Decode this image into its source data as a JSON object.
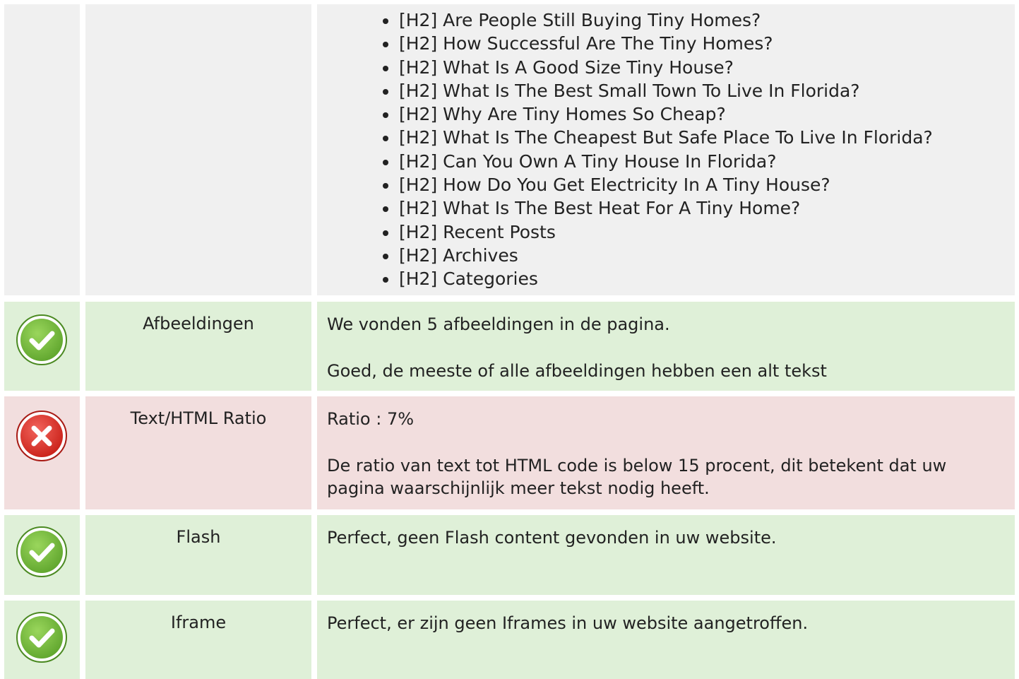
{
  "headings": {
    "items": [
      "[H2] Are People Still Buying Tiny Homes?",
      "[H2] How Successful Are The Tiny Homes?",
      "[H2] What Is A Good Size Tiny House?",
      "[H2] What Is The Best Small Town To Live In Florida?",
      "[H2] Why Are Tiny Homes So Cheap?",
      "[H2] What Is The Cheapest But Safe Place To Live In Florida?",
      "[H2] Can You Own A Tiny House In Florida?",
      "[H2] How Do You Get Electricity In A Tiny House?",
      "[H2] What Is The Best Heat For A Tiny Home?",
      "[H2] Recent Posts",
      "[H2] Archives",
      "[H2] Categories"
    ]
  },
  "checks": {
    "images": {
      "label": "Afbeeldingen",
      "status": "pass",
      "line1": "We vonden 5 afbeeldingen in de pagina.",
      "line2": "Goed, de meeste of alle afbeeldingen hebben een alt tekst"
    },
    "ratio": {
      "label": "Text/HTML Ratio",
      "status": "fail",
      "line1": "Ratio : 7%",
      "line2": "De ratio van text tot HTML code is below 15 procent, dit betekent dat uw pagina waarschijnlijk meer tekst nodig heeft."
    },
    "flash": {
      "label": "Flash",
      "status": "pass",
      "line1": "Perfect, geen Flash content gevonden in uw website."
    },
    "iframe": {
      "label": "Iframe",
      "status": "pass",
      "line1": "Perfect, er zijn geen Iframes in uw website aangetroffen."
    }
  },
  "icons": {
    "pass": "check-circle-icon",
    "fail": "error-circle-icon"
  },
  "colors": {
    "pass_bg": "#dff0d8",
    "fail_bg": "#f2dede",
    "neutral_bg": "#f0f0f0",
    "pass_icon": "#7cc243",
    "fail_icon": "#e0342c"
  }
}
